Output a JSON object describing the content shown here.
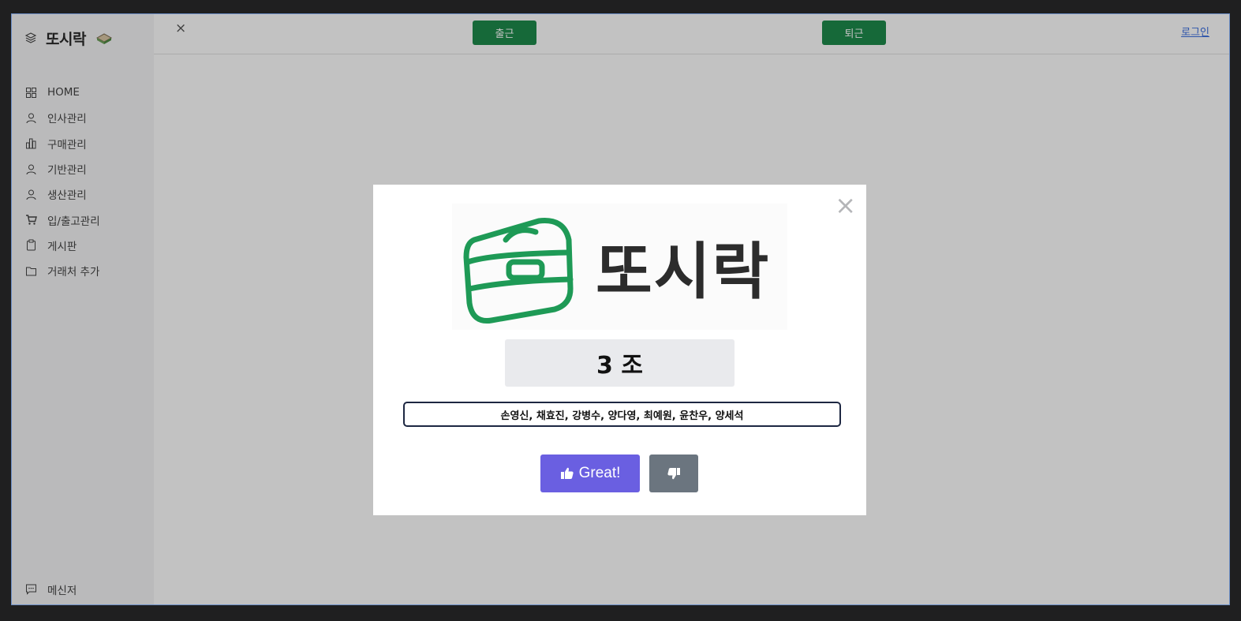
{
  "brand": {
    "title": "또시락"
  },
  "sidebar": {
    "items": [
      {
        "label": "HOME",
        "icon": "grid-icon"
      },
      {
        "label": "인사관리",
        "icon": "user-icon"
      },
      {
        "label": "구매관리",
        "icon": "bar-chart-icon"
      },
      {
        "label": "기반관리",
        "icon": "user-icon"
      },
      {
        "label": "생산관리",
        "icon": "user-icon"
      },
      {
        "label": "입/출고관리",
        "icon": "cart-icon"
      },
      {
        "label": "게시판",
        "icon": "clipboard-icon"
      },
      {
        "label": "거래처 추가",
        "icon": "folder-icon"
      }
    ],
    "bottom": {
      "label": "메신저",
      "icon": "message-icon"
    }
  },
  "topbar": {
    "close_label": "×",
    "checkin_label": "출근",
    "checkout_label": "퇴근",
    "login_label": "로그인"
  },
  "modal": {
    "close_label": "×",
    "logo_text": "또시락",
    "team_label": "3 조",
    "members": "손영신, 채효진, 강병수, 양다영, 최예원, 윤찬우, 양세석",
    "great_label": "Great!",
    "colors": {
      "accent": "#6a5fe1",
      "secondary": "#6b757f",
      "logo_green": "#1e9a56"
    }
  }
}
